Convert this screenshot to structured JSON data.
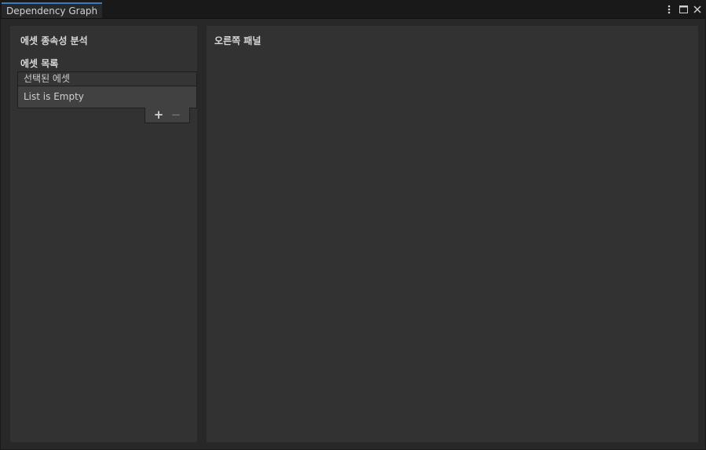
{
  "window": {
    "tab_title": "Dependency Graph",
    "controls": [
      {
        "icon": "more-options-icon"
      },
      {
        "icon": "maximize-icon"
      },
      {
        "icon": "close-icon"
      }
    ]
  },
  "left_panel": {
    "title": "에셋 종속성 분석",
    "list_label": "에셋 목록",
    "list_header": "선택된 에셋",
    "empty_text": "List is Empty",
    "add_label": "+",
    "remove_label": "−"
  },
  "right_panel": {
    "title": "오른쪽 패널"
  },
  "colors": {
    "accent": "#3a79bb",
    "panel_bg": "#323232",
    "window_bg": "#282828"
  }
}
